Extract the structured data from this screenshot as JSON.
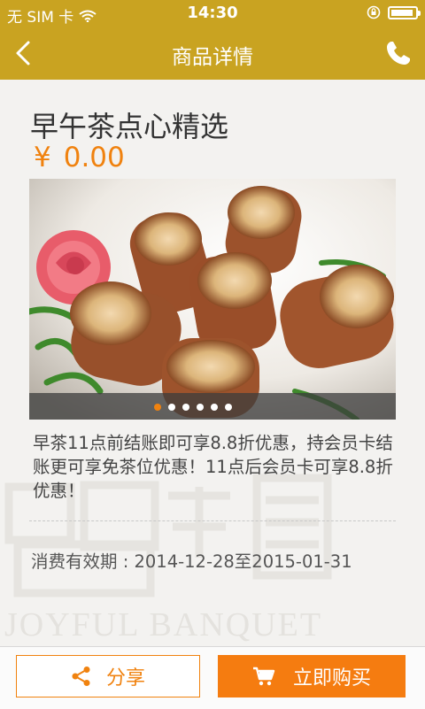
{
  "status_bar": {
    "carrier": "无 SIM 卡",
    "time": "14:30",
    "icons": [
      "wifi-icon",
      "orientation-lock-icon",
      "battery-icon"
    ]
  },
  "nav": {
    "title": "商品详情",
    "back_icon": "back-chevron-icon",
    "phone_icon": "phone-icon"
  },
  "product": {
    "name": "早午茶点心精选",
    "currency": "¥",
    "price": "0.00",
    "image": "dim-sum-rolls-photo",
    "carousel": {
      "total": 6,
      "active": 1
    },
    "description": "早茶11点前结账即可享8.8折优惠，持会员卡结账更可享免茶位优惠！11点后会员卡可享8.8折优惠！",
    "validity_label": "消费有效期 : ",
    "validity_range": "2014-12-28至2015-01-31"
  },
  "watermark": {
    "text": "JOYFUL BANQUET"
  },
  "footer": {
    "share_label": "分享",
    "buy_label": "立即购买"
  },
  "colors": {
    "nav": "#c9a321",
    "accent": "#f0820f",
    "buy": "#f57c10"
  }
}
